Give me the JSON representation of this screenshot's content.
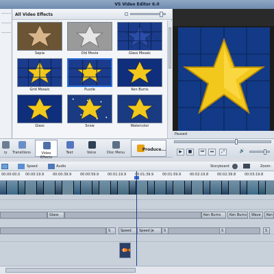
{
  "app": {
    "title": "VS Video Editor 6.0"
  },
  "effects": {
    "header": "All Video Effects",
    "items": [
      {
        "label": "Sepia"
      },
      {
        "label": "Old Movie"
      },
      {
        "label": "Glass Mosaic"
      },
      {
        "label": "Grid Mosaic"
      },
      {
        "label": "Puzzle",
        "selected": true
      },
      {
        "label": "Ken Burns"
      },
      {
        "label": "Glass"
      },
      {
        "label": "Snow"
      },
      {
        "label": "Watercolor"
      }
    ]
  },
  "toolbar": {
    "items": [
      {
        "label": "ry",
        "icon": "library-icon"
      },
      {
        "label": "Transitions",
        "icon": "transitions-icon"
      },
      {
        "label": "Video Effects",
        "icon": "video-effects-icon",
        "active": true
      },
      {
        "label": "Text",
        "icon": "text-icon"
      },
      {
        "label": "Voice",
        "icon": "voice-icon"
      },
      {
        "label": "Disc Menu",
        "icon": "disc-menu-icon"
      },
      {
        "label": "Produce...",
        "icon": "produce-icon"
      }
    ]
  },
  "preview": {
    "status": "Paused"
  },
  "timeline": {
    "toolbar": {
      "speed": "Speed",
      "audio": "Audio",
      "storyboard": "Storyboard",
      "zoom": "Zoom:"
    },
    "ruler": [
      "00:00:00.0",
      "00:00:19.9",
      "00:00:39.9",
      "00:00:59.9",
      "00:01:19.9",
      "00:01:39.9",
      "00:01:59.9",
      "00:02:19.8",
      "00:02:39.8",
      "00:03:19.8"
    ],
    "fx_pills": [
      "Glass",
      "Ken Burns",
      "Ken Burns",
      "Wave",
      "Ken"
    ],
    "audio_pills": [
      "S",
      "Speed",
      "Speed Je",
      "S",
      "S",
      "S"
    ]
  },
  "colors": {
    "accent": "#2f6fd6",
    "star": "#f2c81c",
    "preview_bg": "#0e2a6e"
  }
}
